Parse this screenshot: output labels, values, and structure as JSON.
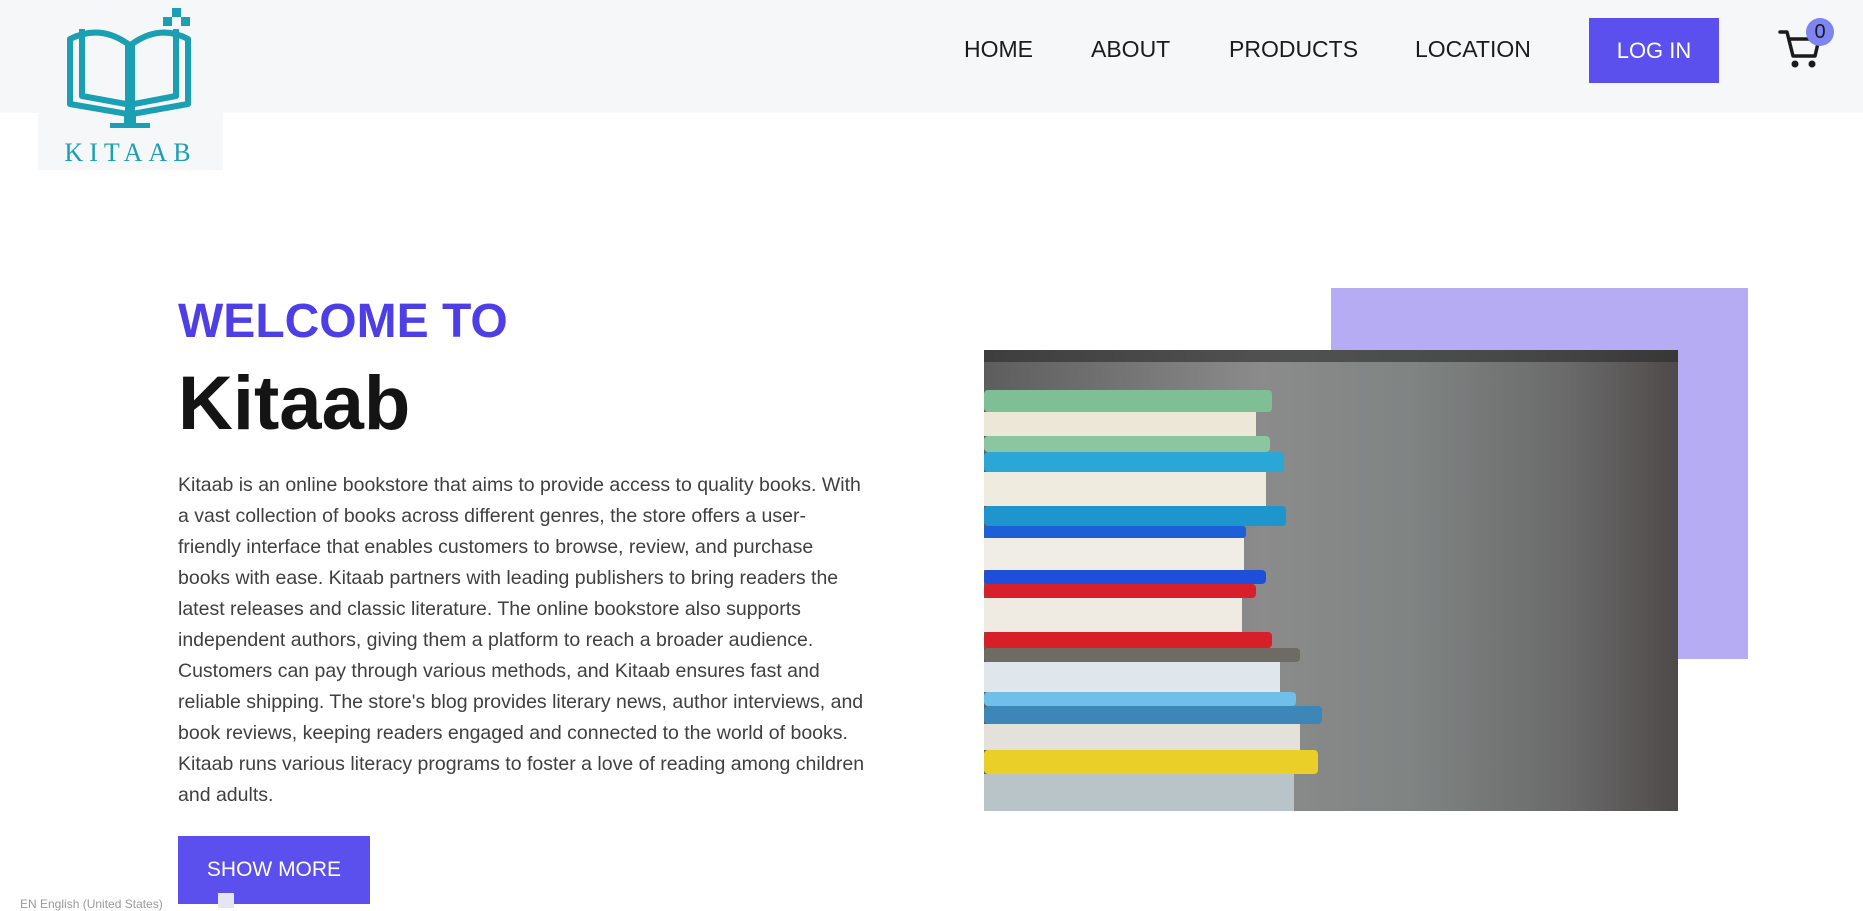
{
  "brand": {
    "logo_text": "KITAAB",
    "logo_icon": "open-book-monitor-icon",
    "accent_color": "#5b4fee",
    "logo_color": "#1a9fb3"
  },
  "nav": {
    "items": [
      {
        "label": "HOME"
      },
      {
        "label": "ABOUT"
      },
      {
        "label": "PRODUCTS"
      },
      {
        "label": "LOCATION"
      }
    ],
    "login_label": "LOG IN",
    "cart_icon": "shopping-cart-icon",
    "cart_count": "0"
  },
  "hero": {
    "eyebrow": "WELCOME TO",
    "title": "Kitaab",
    "description": "Kitaab is an online bookstore that aims to provide access to quality books. With a vast collection of books across different genres, the store offers a user-friendly interface that enables customers to browse, review, and purchase books with ease. Kitaab partners with leading publishers to bring readers the latest releases and classic literature. The online bookstore also supports independent authors, giving them a platform to reach a broader audience. Customers can pay through various methods, and Kitaab ensures fast and reliable shipping. The store's blog provides literary news, author interviews, and book reviews, keeping readers engaged and connected to the world of books. Kitaab runs various literacy programs to foster a love of reading among children and adults.",
    "cta_label": "SHOW MORE",
    "image_icon": "stacked-books-photo",
    "accent_block_color": "#b6acf4"
  },
  "footer": {
    "language_label": "EN English (United States)"
  }
}
